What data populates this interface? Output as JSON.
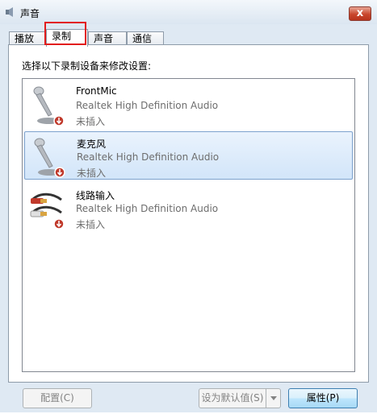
{
  "window": {
    "title": "声音",
    "close_label": "x"
  },
  "tabs": [
    {
      "label": "播放",
      "active": false
    },
    {
      "label": "录制",
      "active": true
    },
    {
      "label": "声音",
      "active": false
    },
    {
      "label": "通信",
      "active": false
    }
  ],
  "instruction": "选择以下录制设备来修改设置:",
  "devices": [
    {
      "name": "FrontMic",
      "driver": "Realtek High Definition Audio",
      "status": "未插入",
      "icon": "microphone-icon",
      "selected": false
    },
    {
      "name": "麦克风",
      "driver": "Realtek High Definition Audio",
      "status": "未插入",
      "icon": "microphone-icon",
      "selected": true
    },
    {
      "name": "线路输入",
      "driver": "Realtek High Definition Audio",
      "status": "未插入",
      "icon": "line-in-cable-icon",
      "selected": false
    }
  ],
  "buttons": {
    "configure": "配置(C)",
    "set_default": "设为默认值(S)",
    "properties": "属性(P)"
  },
  "colors": {
    "selection": "#d2e5f9",
    "highlight_box": "#e21c1c",
    "close_button": "#c9462c"
  }
}
